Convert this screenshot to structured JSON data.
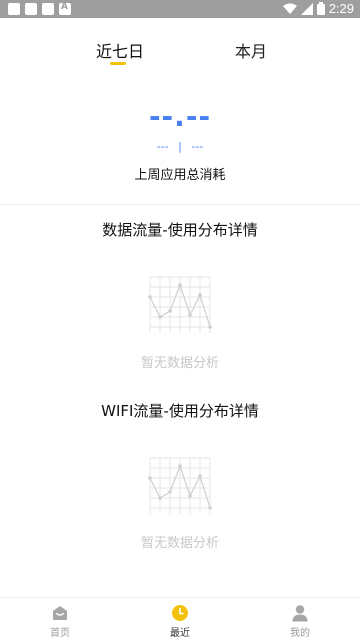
{
  "status_bar": {
    "time": "2:29",
    "icons": [
      "image-icon",
      "square-icon",
      "sd-card-icon",
      "a-icon",
      "wifi-icon",
      "signal-icon",
      "battery-icon"
    ]
  },
  "tabs": [
    {
      "label": "近七日",
      "active": true
    },
    {
      "label": "本月",
      "active": false
    }
  ],
  "summary": {
    "total_value": "--.--",
    "sub_value_left": "---",
    "sub_separator": "|",
    "sub_value_right": "---",
    "label": "上周应用总消耗"
  },
  "sections": [
    {
      "title": "数据流量-使用分布详情",
      "empty_text": "暂无数据分析"
    },
    {
      "title": "WIFI流量-使用分布详情",
      "empty_text": "暂无数据分析"
    }
  ],
  "nav": [
    {
      "label": "首页",
      "icon": "home-icon",
      "active": false
    },
    {
      "label": "最近",
      "icon": "clock-icon",
      "active": true
    },
    {
      "label": "我的",
      "icon": "person-icon",
      "active": false
    }
  ],
  "colors": {
    "accent_yellow": "#f2c10b",
    "value_blue": "#4a7ff0",
    "status_bar": "#9e9e9e",
    "empty_gray": "#c8c8c8"
  }
}
